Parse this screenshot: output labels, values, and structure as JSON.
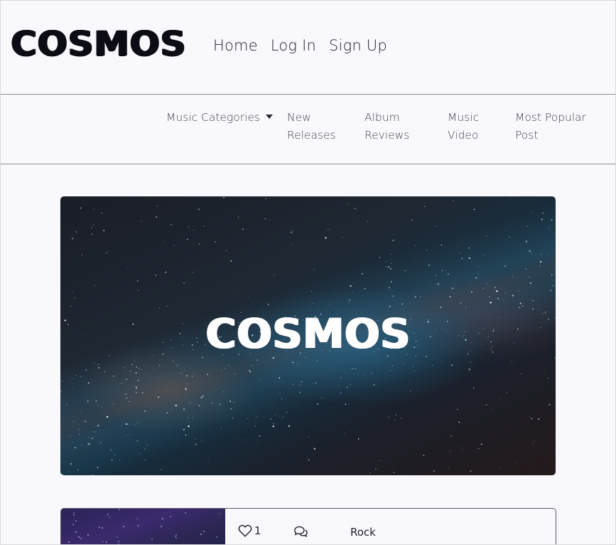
{
  "brand": {
    "logo_text": "COSMOS"
  },
  "main_nav": {
    "items": [
      {
        "label": "Home"
      },
      {
        "label": "Log In"
      },
      {
        "label": "Sign Up"
      }
    ]
  },
  "sub_nav": {
    "categories_label": "Music Categories",
    "new_releases_line1": "New",
    "new_releases_line2": "Releases",
    "album_reviews_line1": "Album",
    "album_reviews_line2": "Reviews",
    "music_video_line1": "Music",
    "music_video_line2": "Video",
    "most_popular_line1": "Most Popular",
    "most_popular_line2": "Post"
  },
  "hero": {
    "title": "COSMOS"
  },
  "post_card": {
    "likes_count": "1",
    "like_icon": "heart-outline-icon",
    "comment_icon": "comments-icon",
    "category": "Rock"
  },
  "colors": {
    "page_background": "#f9f8fc",
    "text_dark": "#0c0c14",
    "divider": "#8d8d93",
    "hero_text": "#ffffff"
  }
}
